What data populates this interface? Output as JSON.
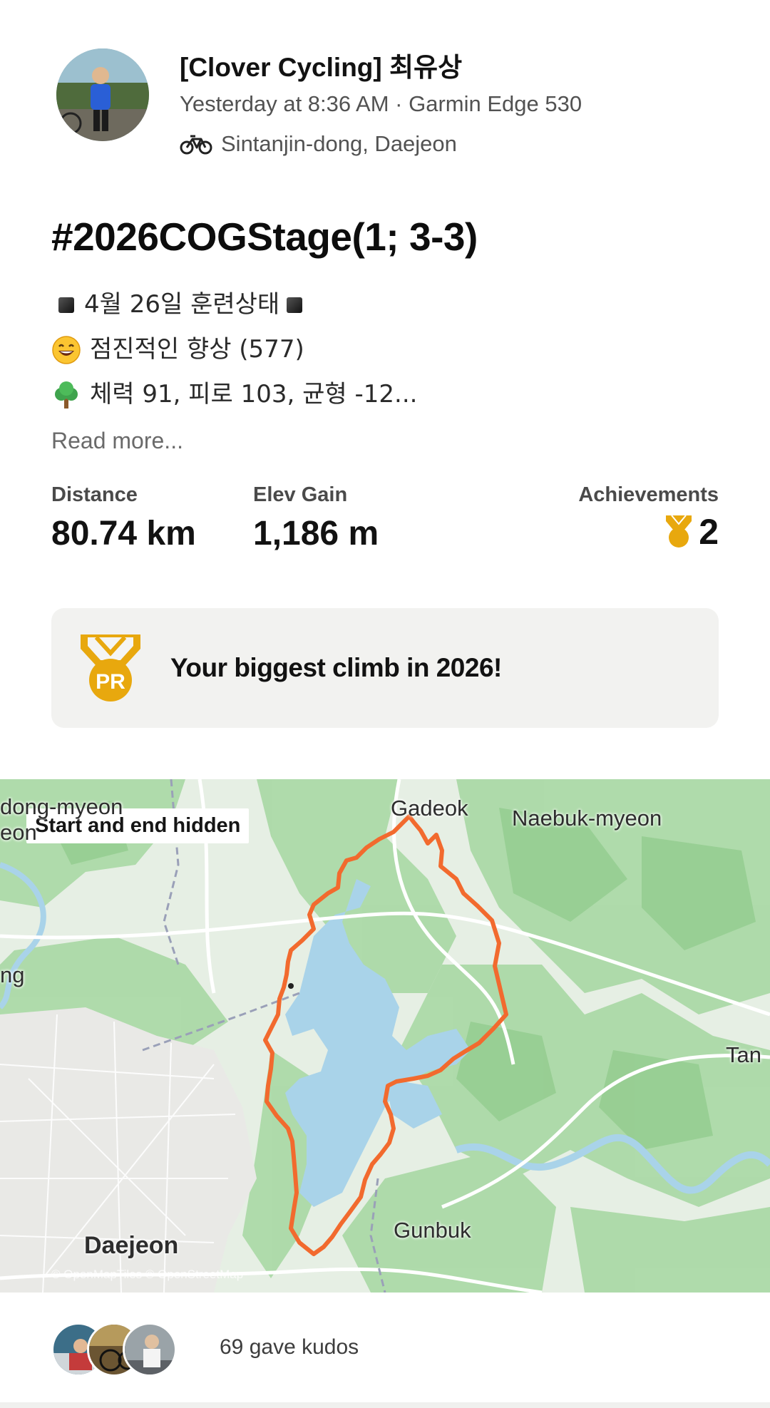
{
  "activity": {
    "athlete_name": "[Clover Cycling] 최유상",
    "meta": "Yesterday at 8:36 AM · Garmin Edge 530",
    "location": "Sintanjin-dong, Daejeon",
    "title": "#2026COGStage(1; 3-3)",
    "description": [
      "4월 26일 훈련상태",
      "점진적인 향상 (577)",
      "체력 91, 피로 103, 균형 -12..."
    ],
    "read_more": "Read more..."
  },
  "stats": {
    "distance": {
      "label": "Distance",
      "value": "80.74 km"
    },
    "elev_gain": {
      "label": "Elev Gain",
      "value": "1,186 m"
    },
    "achievements": {
      "label": "Achievements",
      "value": "2"
    }
  },
  "pr_card": {
    "badge": "PR",
    "text": "Your biggest climb in 2026!"
  },
  "map": {
    "badge": "Start and end hidden",
    "labels": {
      "gadeok": "Gadeok",
      "naebuk": "Naebuk-myeon",
      "dong_myeon": "dong-myeon",
      "eon": "eon",
      "ng": "ng",
      "tan": "Tan",
      "gunbuk": "Gunbuk",
      "daejeon": "Daejeon"
    },
    "copyright": "© OpenMapTiles © OpenStreetMap"
  },
  "kudos": {
    "text": "69 gave kudos"
  },
  "colors": {
    "route": "#f26a2e",
    "gold": "#e8a80e",
    "water": "#a9d3e9",
    "forest": "#a9d8a4"
  }
}
